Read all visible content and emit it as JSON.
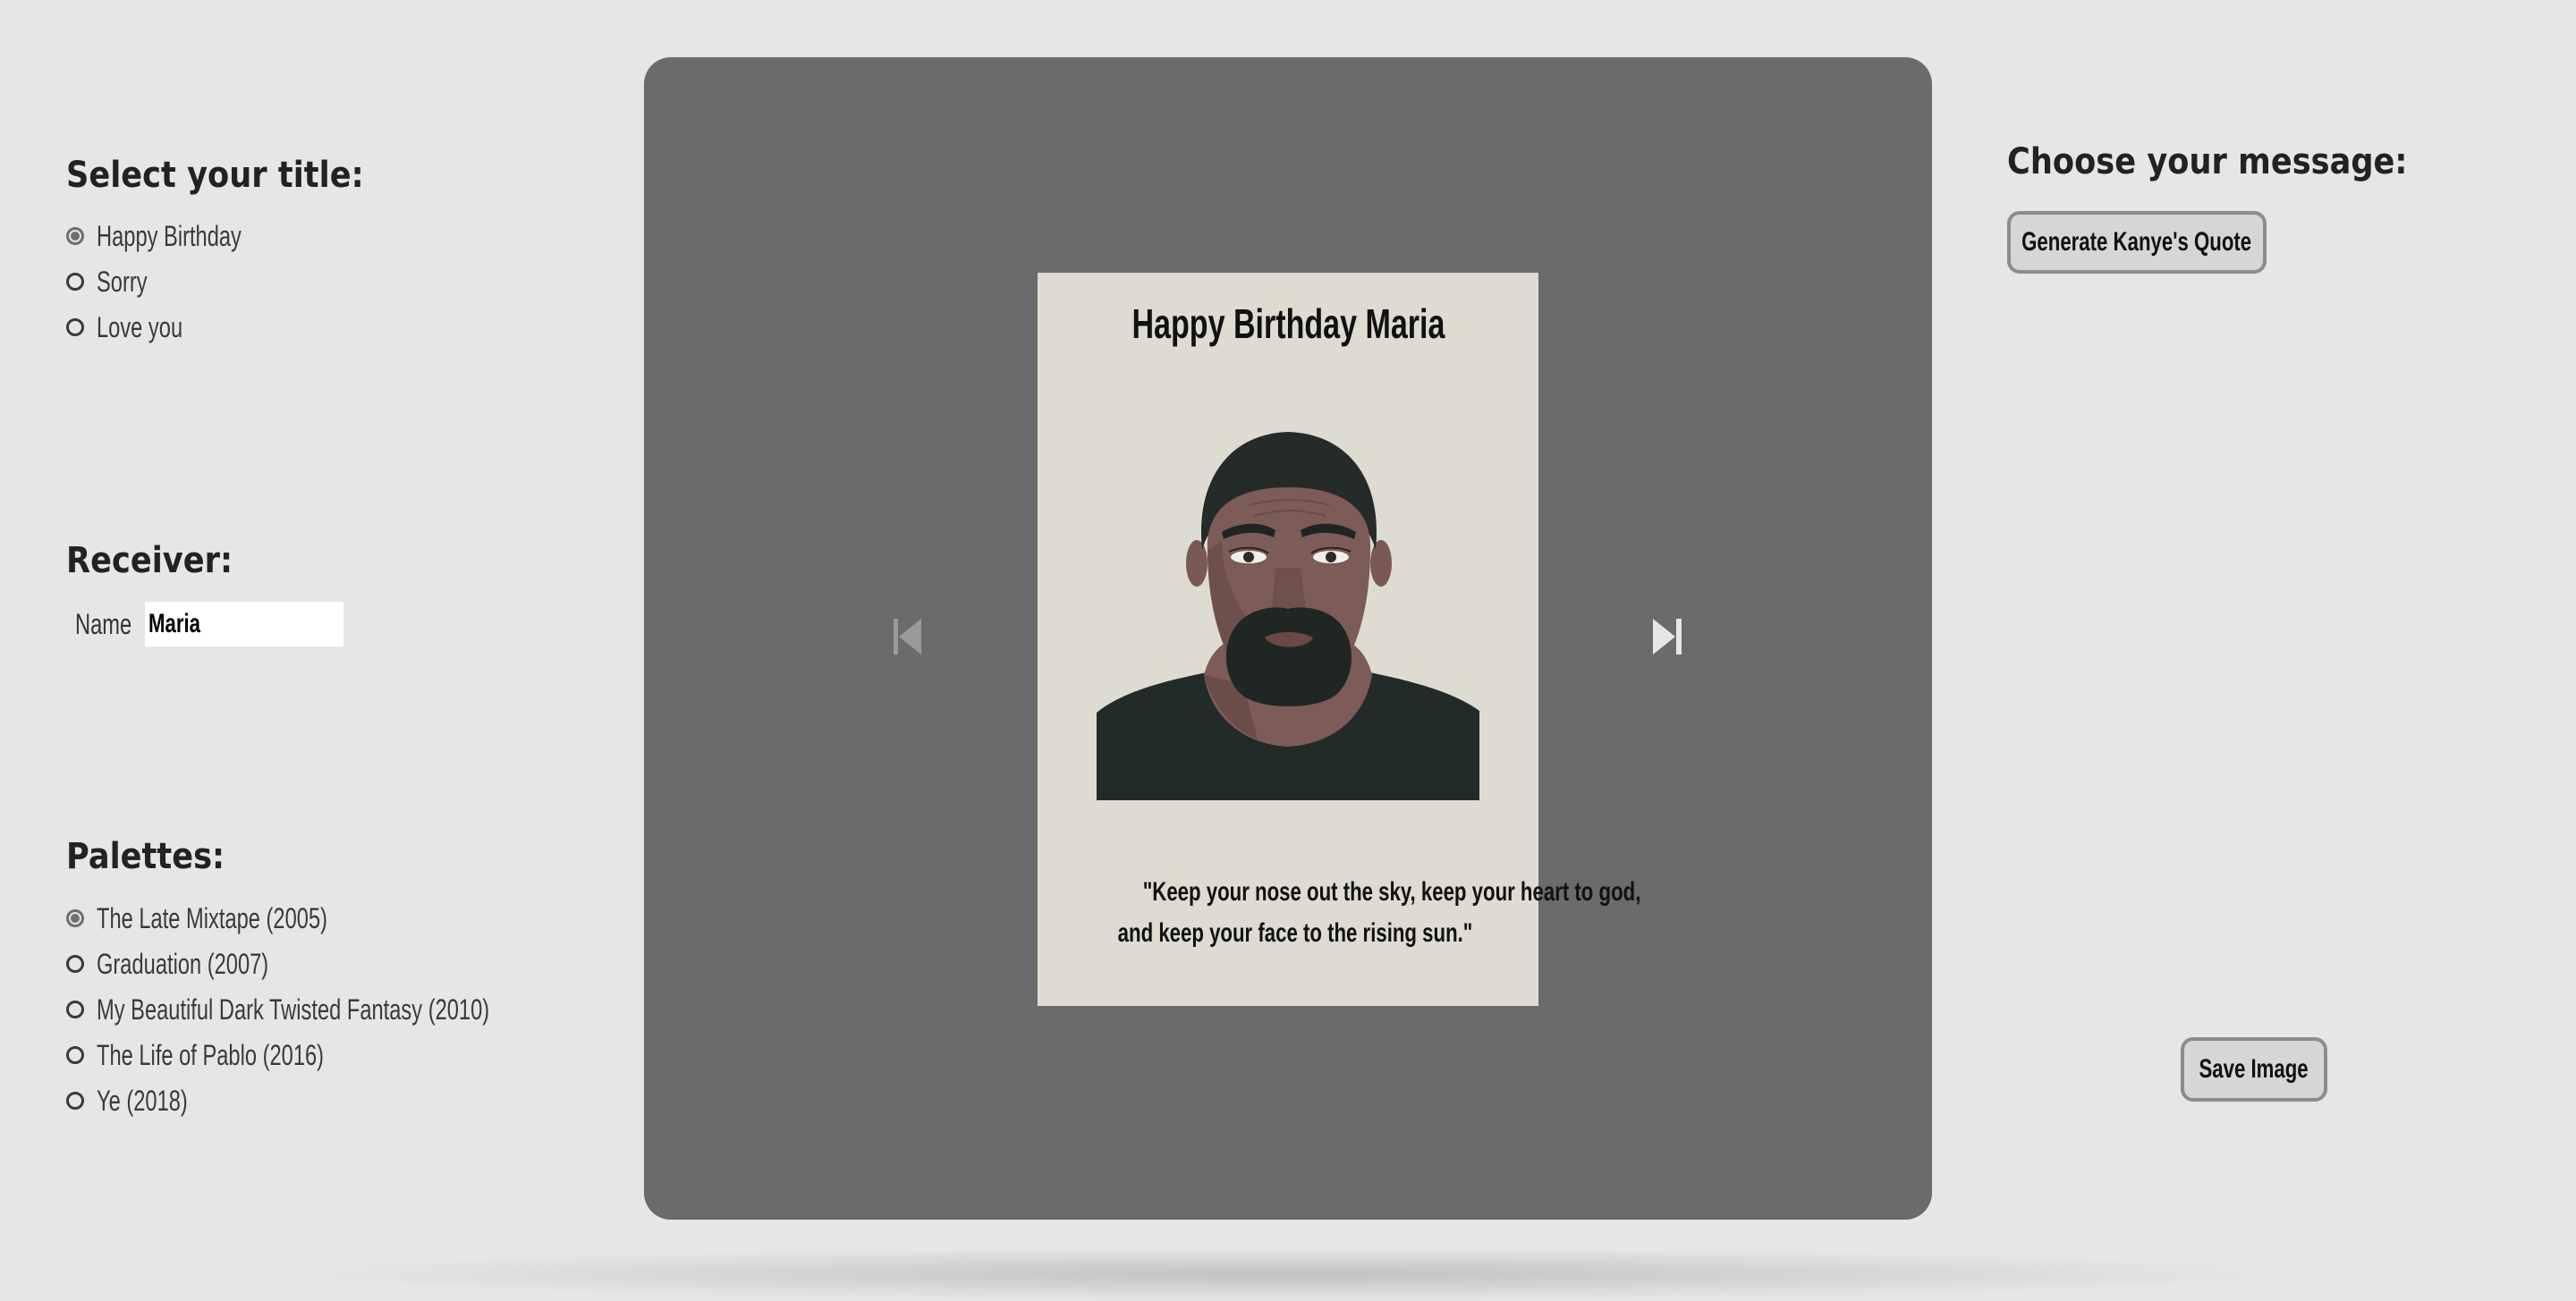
{
  "title_section": {
    "heading": "Select your title:",
    "options": [
      {
        "label": "Happy Birthday",
        "checked": true
      },
      {
        "label": "Sorry",
        "checked": false
      },
      {
        "label": "Love you",
        "checked": false
      }
    ]
  },
  "receiver": {
    "heading": "Receiver:",
    "name_label": "Name",
    "name_value": "Maria"
  },
  "palettes": {
    "heading": "Palettes:",
    "options": [
      {
        "label": "The Late Mixtape (2005)",
        "checked": true
      },
      {
        "label": "Graduation (2007)",
        "checked": false
      },
      {
        "label": "My Beautiful Dark Twisted Fantasy (2010)",
        "checked": false
      },
      {
        "label": "The Life of Pablo (2016)",
        "checked": false
      },
      {
        "label": "Ye (2018)",
        "checked": false
      }
    ]
  },
  "card": {
    "title": "Happy Birthday Maria",
    "quote_line1": "\"Keep your nose out the sky, keep your heart to god,",
    "quote_line2": "and keep your face to the rising sun.\"",
    "background_color": "#dedbd0"
  },
  "message": {
    "heading": "Choose your message:",
    "generate_button": "Generate Kanye's Quote"
  },
  "save_button": "Save Image",
  "colors": {
    "page_background": "#e6e6e6",
    "stage_background": "#6b6b6b",
    "button_background": "#d6d6d6",
    "button_border": "#8c8c8c"
  },
  "icons": {
    "previous": "skip-previous-icon",
    "next": "skip-next-icon"
  }
}
